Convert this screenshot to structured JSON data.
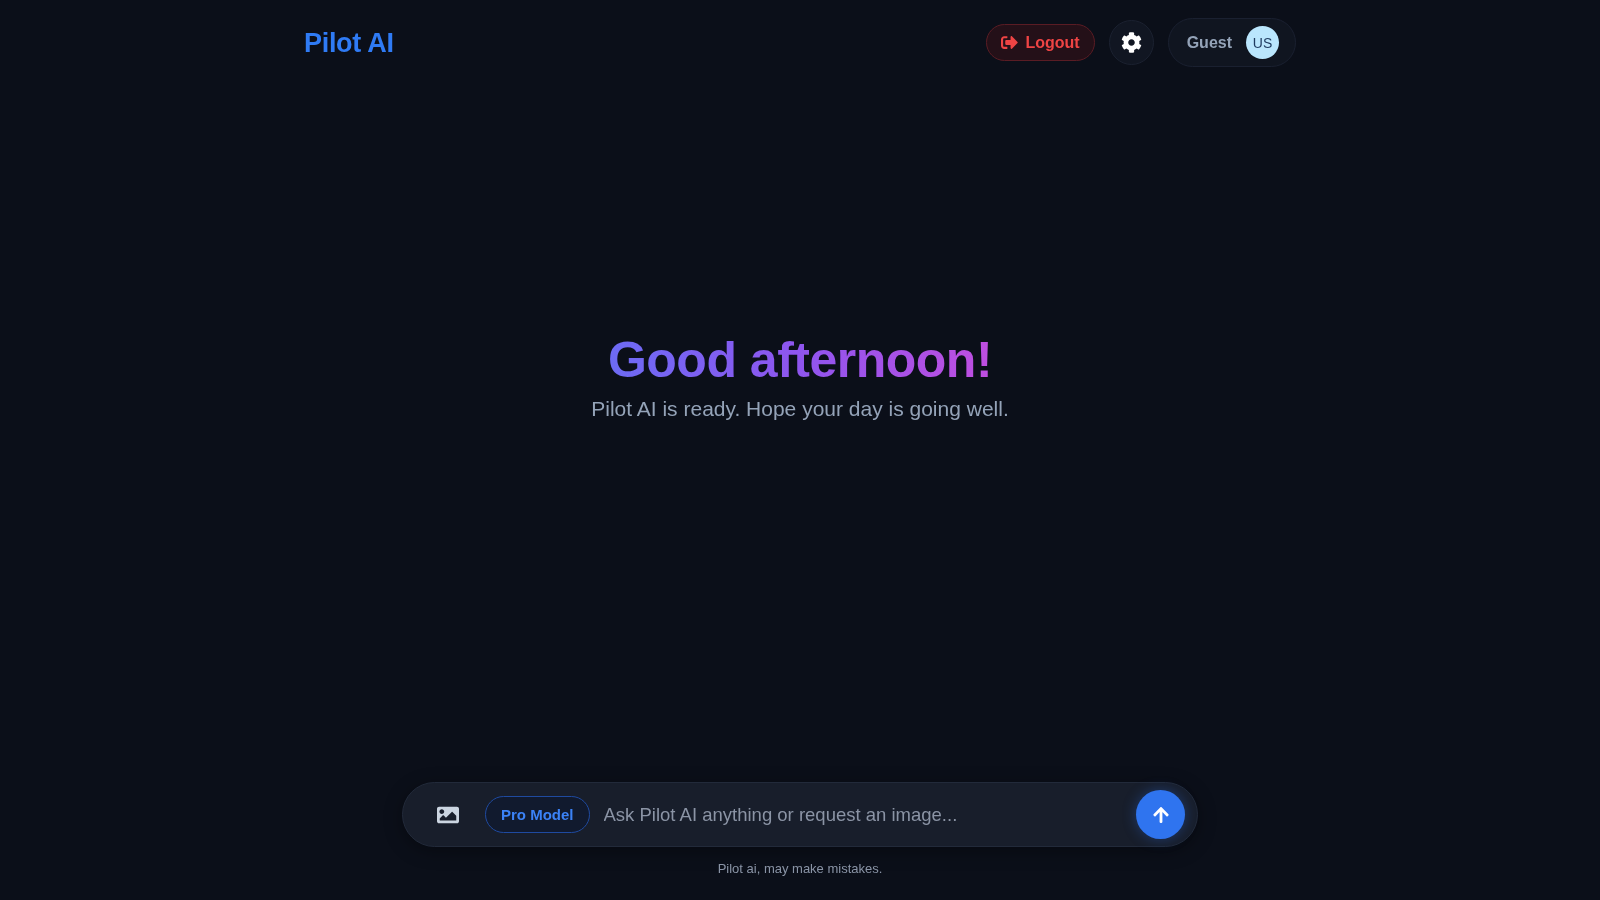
{
  "header": {
    "logo": "Pilot AI",
    "logout_button": "Logout",
    "user": {
      "name": "Guest",
      "initials": "US"
    }
  },
  "greeting": {
    "title": "Good afternoon!",
    "subtitle": "Pilot AI is ready. Hope your day is going well."
  },
  "composer": {
    "model_badge": "Pro Model",
    "placeholder": "Ask Pilot AI anything or request an image..."
  },
  "disclaimer": "Pilot ai, may make mistakes."
}
